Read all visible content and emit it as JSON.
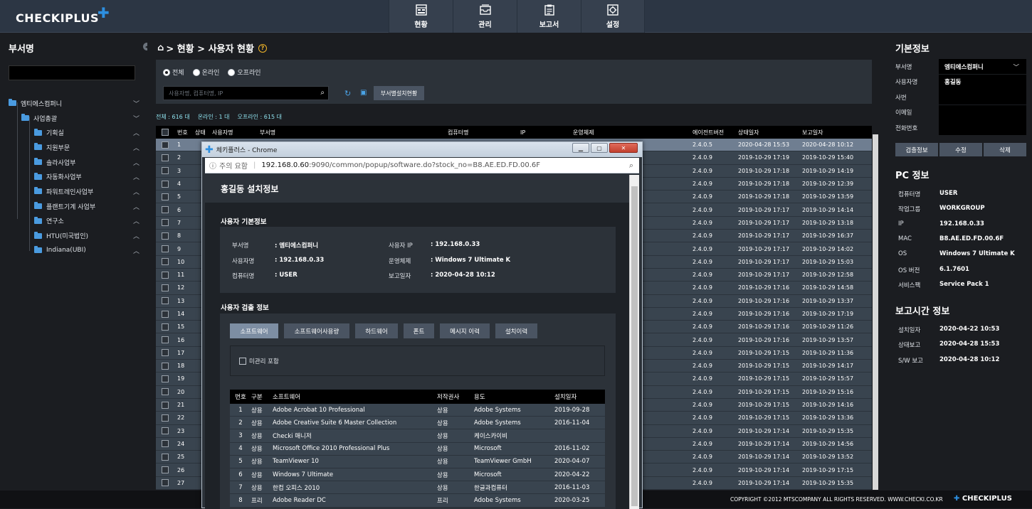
{
  "app": {
    "logo_text": "CHECKIPLUS",
    "nav": [
      {
        "label": "현황",
        "icon": "dashboard-icon"
      },
      {
        "label": "관리",
        "icon": "inbox-icon"
      },
      {
        "label": "보고서",
        "icon": "clipboard-icon"
      },
      {
        "label": "설정",
        "icon": "settings-icon"
      }
    ]
  },
  "left": {
    "title": "부서명",
    "search_value": "",
    "tree": [
      {
        "label": "엠티에스컴퍼니",
        "level": 0,
        "chevron": "﹀"
      },
      {
        "label": "사업총괄",
        "level": 1,
        "chevron": "﹀"
      },
      {
        "label": "기획실",
        "level": 2,
        "chevron": "︿"
      },
      {
        "label": "지원부문",
        "level": 2,
        "chevron": "︿"
      },
      {
        "label": "솔라사업부",
        "level": 2,
        "chevron": "︿"
      },
      {
        "label": "자동화사업부",
        "level": 2,
        "chevron": "︿"
      },
      {
        "label": "파워트레인사업부",
        "level": 2,
        "chevron": "︿"
      },
      {
        "label": "플랜트기계 사업부",
        "level": 2,
        "chevron": "︿"
      },
      {
        "label": "연구소",
        "level": 2,
        "chevron": "︿"
      },
      {
        "label": "HTU(미국법인)",
        "level": 2,
        "chevron": "︿"
      },
      {
        "label": "Indiana(UBI)",
        "level": 2,
        "chevron": "︿"
      }
    ]
  },
  "main": {
    "breadcrumb": "> 현황 > 사용자 현황",
    "filters": {
      "all": "전체",
      "online": "온라인",
      "offline": "오프라인"
    },
    "search_placeholder": "사용자명, 컴퓨터명, IP",
    "dept_button": "부서별설치현황",
    "counts": {
      "total": "전체 : 616 대",
      "online": "온라인 : 1 대",
      "offline": "오프라인 : 615 대"
    },
    "columns": {
      "no": "번호",
      "status": "상태",
      "user": "사용자명",
      "dept": "부서명",
      "computer": "컴퓨터명",
      "ip": "IP",
      "os": "운영체제",
      "agent": "에이전트버전",
      "state_date": "상태일자",
      "report_date": "보고일자"
    },
    "rows": [
      {
        "no": "1",
        "os_tail": "K",
        "agent": "2.4.0.5",
        "state": "2020-04-28 15:53",
        "report": "2020-04-28 10:12"
      },
      {
        "no": "2",
        "os_tail": "",
        "agent": "2.4.0.9",
        "state": "2019-10-29 17:19",
        "report": "2019-10-29 15:40"
      },
      {
        "no": "3",
        "os_tail": "",
        "agent": "2.4.0.9",
        "state": "2019-10-29 17:18",
        "report": "2019-10-29 14:19"
      },
      {
        "no": "4",
        "os_tail": "",
        "agent": "2.4.0.9",
        "state": "2019-10-29 17:18",
        "report": "2019-10-29 12:39"
      },
      {
        "no": "5",
        "os_tail": "nal K",
        "agent": "2.4.0.9",
        "state": "2019-10-29 17:18",
        "report": "2019-10-29 13:59"
      },
      {
        "no": "6",
        "os_tail": "",
        "agent": "2.4.0.9",
        "state": "2019-10-29 17:17",
        "report": "2019-10-29 14:14"
      },
      {
        "no": "7",
        "os_tail": "se",
        "agent": "2.4.0.9",
        "state": "2019-10-29 17:17",
        "report": "2019-10-29 13:18"
      },
      {
        "no": "8",
        "os_tail": "nal K",
        "agent": "2.4.0.9",
        "state": "2019-10-29 17:17",
        "report": "2019-10-29 16:37"
      },
      {
        "no": "9",
        "os_tail": "K",
        "agent": "2.4.0.9",
        "state": "2019-10-29 17:17",
        "report": "2019-10-29 14:02"
      },
      {
        "no": "10",
        "os_tail": "",
        "agent": "2.4.0.9",
        "state": "2019-10-29 17:17",
        "report": "2019-10-29 15:03"
      },
      {
        "no": "11",
        "os_tail": "",
        "agent": "2.4.0.9",
        "state": "2019-10-29 17:17",
        "report": "2019-10-29 12:58"
      },
      {
        "no": "12",
        "os_tail": "nal K",
        "agent": "2.4.0.9",
        "state": "2019-10-29 17:16",
        "report": "2019-10-29 14:58"
      },
      {
        "no": "13",
        "os_tail": "",
        "agent": "2.4.0.9",
        "state": "2019-10-29 17:16",
        "report": "2019-10-29 13:37"
      },
      {
        "no": "14",
        "os_tail": "",
        "agent": "2.4.0.9",
        "state": "2019-10-29 17:16",
        "report": "2019-10-29 17:19"
      },
      {
        "no": "15",
        "os_tail": "se",
        "agent": "2.4.0.9",
        "state": "2019-10-29 17:16",
        "report": "2019-10-29 11:26"
      },
      {
        "no": "16",
        "os_tail": "se",
        "agent": "2.4.0.9",
        "state": "2019-10-29 17:16",
        "report": "2019-10-29 13:57"
      },
      {
        "no": "17",
        "os_tail": "",
        "agent": "2.4.0.9",
        "state": "2019-10-29 17:15",
        "report": "2019-10-29 11:36"
      },
      {
        "no": "18",
        "os_tail": "nal K",
        "agent": "2.4.0.9",
        "state": "2019-10-29 17:15",
        "report": "2019-10-29 14:17"
      },
      {
        "no": "19",
        "os_tail": "",
        "agent": "2.4.0.9",
        "state": "2019-10-29 17:15",
        "report": "2019-10-29 15:57"
      },
      {
        "no": "20",
        "os_tail": "se",
        "agent": "2.4.0.9",
        "state": "2019-10-29 17:15",
        "report": "2019-10-29 15:16"
      },
      {
        "no": "21",
        "os_tail": "Workstations",
        "agent": "2.4.0.9",
        "state": "2019-10-29 17:15",
        "report": "2019-10-29 14:16"
      },
      {
        "no": "22",
        "os_tail": "Workstations",
        "agent": "2.4.0.9",
        "state": "2019-10-29 17:15",
        "report": "2019-10-29 13:36"
      },
      {
        "no": "23",
        "os_tail": "nal K",
        "agent": "2.4.0.9",
        "state": "2019-10-29 17:14",
        "report": "2019-10-29 15:35"
      },
      {
        "no": "24",
        "os_tail": "nal K",
        "agent": "2.4.0.9",
        "state": "2019-10-29 17:14",
        "report": "2019-10-29 14:56"
      },
      {
        "no": "25",
        "os_tail": "",
        "agent": "2.4.0.9",
        "state": "2019-10-29 17:14",
        "report": "2019-10-29 13:52"
      },
      {
        "no": "26",
        "os_tail": "",
        "agent": "2.4.0.9",
        "state": "2019-10-29 17:14",
        "report": "2019-10-29 17:15"
      },
      {
        "no": "27",
        "os_tail": "nal K",
        "agent": "2.4.0.9",
        "state": "2019-10-29 17:14",
        "report": "2019-10-29 15:35"
      }
    ]
  },
  "right": {
    "title": "기본정보",
    "fields": [
      {
        "label": "부서명",
        "value": "엠티에스컴퍼니",
        "dropdown": true
      },
      {
        "label": "사용자명",
        "value": "홍길동"
      },
      {
        "label": "사번",
        "value": ""
      },
      {
        "label": "이메일",
        "value": ""
      },
      {
        "label": "전화번호",
        "value": ""
      }
    ],
    "buttons": {
      "detect": "검출정보",
      "edit": "수정",
      "delete": "삭제"
    },
    "pc_title": "PC 정보",
    "pc": [
      {
        "label": "컴퓨터명",
        "value": "USER"
      },
      {
        "label": "작업그룹",
        "value": "WORKGROUP"
      },
      {
        "label": "IP",
        "value": "192.168.0.33"
      },
      {
        "label": "MAC",
        "value": "B8.AE.ED.FD.00.6F"
      },
      {
        "label": "OS",
        "value": "Windows 7 Ultimate K"
      },
      {
        "label": "OS 버전",
        "value": "6.1.7601"
      },
      {
        "label": "서비스팩",
        "value": "Service Pack 1"
      }
    ],
    "report_title": "보고시간 정보",
    "report": [
      {
        "label": "설치일자",
        "value": "2020-04-22 10:53"
      },
      {
        "label": "상태보고",
        "value": "2020-04-28 15:53"
      },
      {
        "label": "S/W 보고",
        "value": "2020-04-28 10:12"
      }
    ]
  },
  "footer": {
    "copyright": "COPYRIGHT ©2012 MTSCOMPANY ALL RIGHTS RESERVED.   WWW.CHECKI.CO.KR",
    "logo": "CHECKIPLUS"
  },
  "popup": {
    "window_title": "체키플러스 - Chrome",
    "addr_warning": "주의 요함",
    "addr_host": "192.168.0.60",
    "addr_path": ":9090/common/popup/software.do?stock_no=B8.AE.ED.FD.00.6F",
    "heading": "홍길동 설치정보",
    "basic_title": "사용자 기본정보",
    "basic": {
      "dept_label": "부서명",
      "dept_value": ": 엠티에스컴퍼니",
      "user_label": "사용자명",
      "user_value": ": 192.168.0.33",
      "computer_label": "컴퓨터명",
      "computer_value": ": USER",
      "ip_label": "사용자 IP",
      "ip_value": ": 192.168.0.33",
      "os_label": "운영체제",
      "os_value": ": Windows 7 Ultimate K",
      "report_label": "보고일자",
      "report_value": ": 2020-04-28 10:12"
    },
    "detect_title": "사용자 검출 정보",
    "tabs": [
      "소프트웨어",
      "소프트웨어사용량",
      "하드웨어",
      "폰트",
      "메시지 이력",
      "설치이력"
    ],
    "unmanaged_label": "미관리 포함",
    "sw_columns": {
      "no": "번호",
      "type": "구분",
      "name": "소프트웨어",
      "license": "저작권사",
      "use": "용도",
      "date": "설치일자"
    },
    "sw_rows": [
      {
        "no": "1",
        "type": "상용",
        "name": "Adobe Acrobat 10 Professional",
        "license": "상용",
        "use": "Adobe Systems",
        "date": "2019-09-28"
      },
      {
        "no": "2",
        "type": "상용",
        "name": "Adobe Creative Suite 6 Master Collection",
        "license": "상용",
        "use": "Adobe Systems",
        "date": "2016-11-04"
      },
      {
        "no": "3",
        "type": "상용",
        "name": "Checki 매니저",
        "license": "상용",
        "use": "케이스카이비",
        "date": ""
      },
      {
        "no": "4",
        "type": "상용",
        "name": "Microsoft Office 2010 Professional Plus",
        "license": "상용",
        "use": "Microsoft",
        "date": "2016-11-02"
      },
      {
        "no": "5",
        "type": "상용",
        "name": "TeamViewer 10",
        "license": "상용",
        "use": "TeamViewer GmbH",
        "date": "2020-04-07"
      },
      {
        "no": "6",
        "type": "상용",
        "name": "Windows 7 Ultimate",
        "license": "상용",
        "use": "Microsoft",
        "date": "2020-04-22"
      },
      {
        "no": "7",
        "type": "상용",
        "name": "한컴 오피스 2010",
        "license": "상용",
        "use": "한글과컴퓨터",
        "date": "2016-11-03"
      },
      {
        "no": "8",
        "type": "프리",
        "name": "Adobe Reader DC",
        "license": "프리",
        "use": "Adobe Systems",
        "date": "2020-03-25"
      }
    ]
  }
}
